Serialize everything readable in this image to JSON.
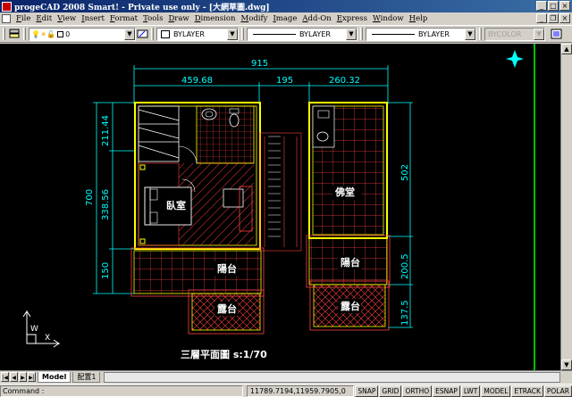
{
  "window": {
    "title": "progeCAD 2008 Smart! - Private use only - [大網草圖.dwg]"
  },
  "menu": [
    "File",
    "Edit",
    "View",
    "Insert",
    "Format",
    "Tools",
    "Draw",
    "Dimension",
    "Modify",
    "Image",
    "Add-On",
    "Express",
    "Window",
    "Help"
  ],
  "toolbar": {
    "layer_value": "0",
    "color_value": "BYLAYER",
    "linetype_value": "BYLAYER",
    "lineweight_value": "BYLAYER",
    "plotstyle_value": "BYCOLOR"
  },
  "drawing": {
    "dims": {
      "overall_top": "915",
      "top_left": "459.68",
      "top_mid": "195",
      "top_right": "260.32",
      "left_overall": "700",
      "left_a": "211.44",
      "left_b": "338.56",
      "left_c": "150",
      "right_a": "502",
      "right_b": "200.5",
      "right_c": "137.5"
    },
    "rooms": {
      "bedroom": "臥室",
      "shrine": "佛堂",
      "balcony_left": "陽台",
      "balcony_right": "陽台",
      "terrace_left": "露台",
      "terrace_right": "露台"
    },
    "caption": "三層平面圖 s:1/70",
    "ucs": {
      "x": "X",
      "y": "W"
    }
  },
  "tabs": {
    "model": "Model",
    "layout": "配置1"
  },
  "status": {
    "command_label": "Command :",
    "coordinates": "11789.7194,11959.7905,0",
    "buttons": [
      "SNAP",
      "GRID",
      "ORTHO",
      "ESNAP",
      "LWT",
      "MODEL",
      "ETRACK",
      "POLAR"
    ]
  },
  "colors": {
    "canvas": "#000000",
    "dim": "#00ffff",
    "wall": "#ffff00",
    "hatch": "#ff4040",
    "room_label": "#ffffff",
    "green_line": "#00ff00"
  }
}
